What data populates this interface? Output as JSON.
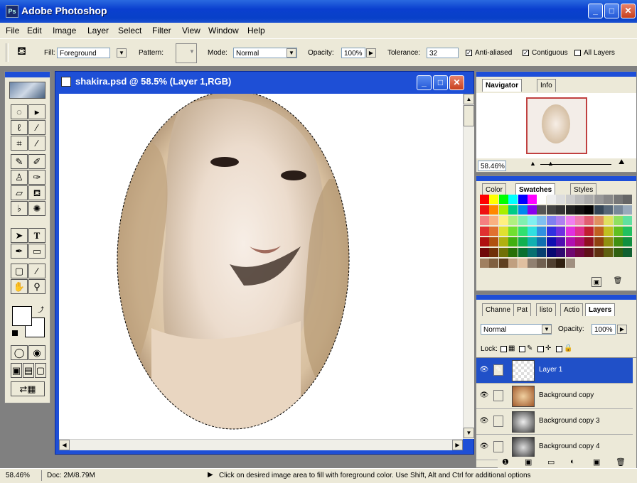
{
  "app": {
    "title": "Adobe Photoshop",
    "logo_text": "Ps"
  },
  "window_controls": {
    "minimize": "_",
    "maximize": "□",
    "close": "✕"
  },
  "menu": [
    "File",
    "Edit",
    "Image",
    "Layer",
    "Select",
    "Filter",
    "View",
    "Window",
    "Help"
  ],
  "options": {
    "fill_label": "Fill:",
    "fill_value": "Foreground",
    "pattern_label": "Pattern:",
    "mode_label": "Mode:",
    "mode_value": "Normal",
    "opacity_label": "Opacity:",
    "opacity_value": "100%",
    "tolerance_label": "Tolerance:",
    "tolerance_value": "32",
    "anti_aliased_label": "Anti-aliased",
    "contiguous_label": "Contiguous",
    "all_layers_label": "All Layers",
    "anti_aliased_checked": true,
    "contiguous_checked": true,
    "all_layers_checked": false
  },
  "document": {
    "title": "shakira.psd @ 58.5% (Layer 1,RGB)"
  },
  "navigator": {
    "tabs": [
      "Navigator",
      "Info"
    ],
    "zoom": "58.46%"
  },
  "color_panel": {
    "tabs": [
      "Color",
      "Swatches",
      "Styles"
    ]
  },
  "layers_panel": {
    "tabs": [
      "Channe",
      "Pat",
      "listo",
      "Actio",
      "Layers"
    ],
    "blend_mode": "Normal",
    "opacity_label": "Opacity:",
    "opacity_value": "100%",
    "lock_label": "Lock:",
    "layers": [
      {
        "name": "Layer 1",
        "selected": true
      },
      {
        "name": "Background copy",
        "selected": false
      },
      {
        "name": "Background copy 3",
        "selected": false
      },
      {
        "name": "Background copy 4",
        "selected": false
      }
    ]
  },
  "status": {
    "zoom": "58.46%",
    "doc": "Doc: 2M/8.79M",
    "hint": "Click on desired image area to fill with foreground color. Use Shift, Alt and Ctrl for additional options"
  },
  "colors": {
    "title_blue": "#0a3fcf",
    "selection_blue": "#2050c8"
  }
}
